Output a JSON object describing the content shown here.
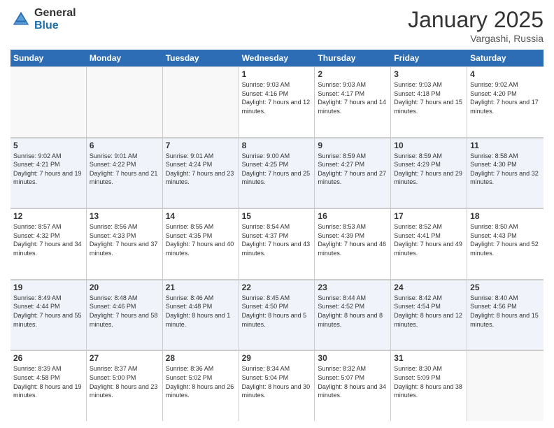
{
  "logo": {
    "general": "General",
    "blue": "Blue"
  },
  "title": "January 2025",
  "location": "Vargashi, Russia",
  "header_days": [
    "Sunday",
    "Monday",
    "Tuesday",
    "Wednesday",
    "Thursday",
    "Friday",
    "Saturday"
  ],
  "weeks": [
    [
      {
        "day": "",
        "sunrise": "",
        "sunset": "",
        "daylight": "",
        "empty": true
      },
      {
        "day": "",
        "sunrise": "",
        "sunset": "",
        "daylight": "",
        "empty": true
      },
      {
        "day": "",
        "sunrise": "",
        "sunset": "",
        "daylight": "",
        "empty": true
      },
      {
        "day": "1",
        "sunrise": "Sunrise: 9:03 AM",
        "sunset": "Sunset: 4:16 PM",
        "daylight": "Daylight: 7 hours and 12 minutes."
      },
      {
        "day": "2",
        "sunrise": "Sunrise: 9:03 AM",
        "sunset": "Sunset: 4:17 PM",
        "daylight": "Daylight: 7 hours and 14 minutes."
      },
      {
        "day": "3",
        "sunrise": "Sunrise: 9:03 AM",
        "sunset": "Sunset: 4:18 PM",
        "daylight": "Daylight: 7 hours and 15 minutes."
      },
      {
        "day": "4",
        "sunrise": "Sunrise: 9:02 AM",
        "sunset": "Sunset: 4:20 PM",
        "daylight": "Daylight: 7 hours and 17 minutes."
      }
    ],
    [
      {
        "day": "5",
        "sunrise": "Sunrise: 9:02 AM",
        "sunset": "Sunset: 4:21 PM",
        "daylight": "Daylight: 7 hours and 19 minutes."
      },
      {
        "day": "6",
        "sunrise": "Sunrise: 9:01 AM",
        "sunset": "Sunset: 4:22 PM",
        "daylight": "Daylight: 7 hours and 21 minutes."
      },
      {
        "day": "7",
        "sunrise": "Sunrise: 9:01 AM",
        "sunset": "Sunset: 4:24 PM",
        "daylight": "Daylight: 7 hours and 23 minutes."
      },
      {
        "day": "8",
        "sunrise": "Sunrise: 9:00 AM",
        "sunset": "Sunset: 4:25 PM",
        "daylight": "Daylight: 7 hours and 25 minutes."
      },
      {
        "day": "9",
        "sunrise": "Sunrise: 8:59 AM",
        "sunset": "Sunset: 4:27 PM",
        "daylight": "Daylight: 7 hours and 27 minutes."
      },
      {
        "day": "10",
        "sunrise": "Sunrise: 8:59 AM",
        "sunset": "Sunset: 4:29 PM",
        "daylight": "Daylight: 7 hours and 29 minutes."
      },
      {
        "day": "11",
        "sunrise": "Sunrise: 8:58 AM",
        "sunset": "Sunset: 4:30 PM",
        "daylight": "Daylight: 7 hours and 32 minutes."
      }
    ],
    [
      {
        "day": "12",
        "sunrise": "Sunrise: 8:57 AM",
        "sunset": "Sunset: 4:32 PM",
        "daylight": "Daylight: 7 hours and 34 minutes."
      },
      {
        "day": "13",
        "sunrise": "Sunrise: 8:56 AM",
        "sunset": "Sunset: 4:33 PM",
        "daylight": "Daylight: 7 hours and 37 minutes."
      },
      {
        "day": "14",
        "sunrise": "Sunrise: 8:55 AM",
        "sunset": "Sunset: 4:35 PM",
        "daylight": "Daylight: 7 hours and 40 minutes."
      },
      {
        "day": "15",
        "sunrise": "Sunrise: 8:54 AM",
        "sunset": "Sunset: 4:37 PM",
        "daylight": "Daylight: 7 hours and 43 minutes."
      },
      {
        "day": "16",
        "sunrise": "Sunrise: 8:53 AM",
        "sunset": "Sunset: 4:39 PM",
        "daylight": "Daylight: 7 hours and 46 minutes."
      },
      {
        "day": "17",
        "sunrise": "Sunrise: 8:52 AM",
        "sunset": "Sunset: 4:41 PM",
        "daylight": "Daylight: 7 hours and 49 minutes."
      },
      {
        "day": "18",
        "sunrise": "Sunrise: 8:50 AM",
        "sunset": "Sunset: 4:43 PM",
        "daylight": "Daylight: 7 hours and 52 minutes."
      }
    ],
    [
      {
        "day": "19",
        "sunrise": "Sunrise: 8:49 AM",
        "sunset": "Sunset: 4:44 PM",
        "daylight": "Daylight: 7 hours and 55 minutes."
      },
      {
        "day": "20",
        "sunrise": "Sunrise: 8:48 AM",
        "sunset": "Sunset: 4:46 PM",
        "daylight": "Daylight: 7 hours and 58 minutes."
      },
      {
        "day": "21",
        "sunrise": "Sunrise: 8:46 AM",
        "sunset": "Sunset: 4:48 PM",
        "daylight": "Daylight: 8 hours and 1 minute."
      },
      {
        "day": "22",
        "sunrise": "Sunrise: 8:45 AM",
        "sunset": "Sunset: 4:50 PM",
        "daylight": "Daylight: 8 hours and 5 minutes."
      },
      {
        "day": "23",
        "sunrise": "Sunrise: 8:44 AM",
        "sunset": "Sunset: 4:52 PM",
        "daylight": "Daylight: 8 hours and 8 minutes."
      },
      {
        "day": "24",
        "sunrise": "Sunrise: 8:42 AM",
        "sunset": "Sunset: 4:54 PM",
        "daylight": "Daylight: 8 hours and 12 minutes."
      },
      {
        "day": "25",
        "sunrise": "Sunrise: 8:40 AM",
        "sunset": "Sunset: 4:56 PM",
        "daylight": "Daylight: 8 hours and 15 minutes."
      }
    ],
    [
      {
        "day": "26",
        "sunrise": "Sunrise: 8:39 AM",
        "sunset": "Sunset: 4:58 PM",
        "daylight": "Daylight: 8 hours and 19 minutes."
      },
      {
        "day": "27",
        "sunrise": "Sunrise: 8:37 AM",
        "sunset": "Sunset: 5:00 PM",
        "daylight": "Daylight: 8 hours and 23 minutes."
      },
      {
        "day": "28",
        "sunrise": "Sunrise: 8:36 AM",
        "sunset": "Sunset: 5:02 PM",
        "daylight": "Daylight: 8 hours and 26 minutes."
      },
      {
        "day": "29",
        "sunrise": "Sunrise: 8:34 AM",
        "sunset": "Sunset: 5:04 PM",
        "daylight": "Daylight: 8 hours and 30 minutes."
      },
      {
        "day": "30",
        "sunrise": "Sunrise: 8:32 AM",
        "sunset": "Sunset: 5:07 PM",
        "daylight": "Daylight: 8 hours and 34 minutes."
      },
      {
        "day": "31",
        "sunrise": "Sunrise: 8:30 AM",
        "sunset": "Sunset: 5:09 PM",
        "daylight": "Daylight: 8 hours and 38 minutes."
      },
      {
        "day": "",
        "sunrise": "",
        "sunset": "",
        "daylight": "",
        "empty": true
      }
    ]
  ]
}
